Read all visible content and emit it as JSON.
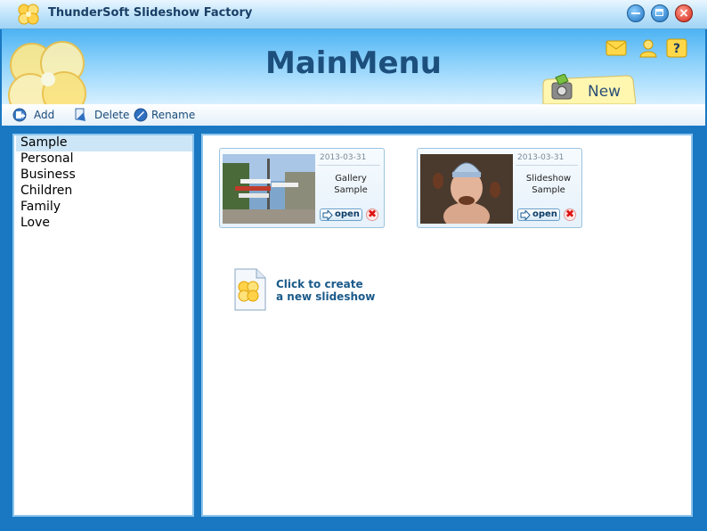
{
  "window": {
    "title": "ThunderSoft Slideshow Factory"
  },
  "header": {
    "title": "MainMenu",
    "new_label": "New"
  },
  "toolbar": {
    "add_label": "Add",
    "delete_label": "Delete",
    "rename_label": "Rename"
  },
  "categories": [
    {
      "label": "Sample",
      "selected": true
    },
    {
      "label": "Personal"
    },
    {
      "label": "Business"
    },
    {
      "label": "Children"
    },
    {
      "label": "Family"
    },
    {
      "label": "Love"
    }
  ],
  "slideshows": [
    {
      "date": "2013-03-31",
      "name_line1": "Gallery",
      "name_line2": "Sample",
      "open_label": "open",
      "delete_glyph": "✖"
    },
    {
      "date": "2013-03-31",
      "name_line1": "Slideshow",
      "name_line2": "Sample",
      "open_label": "open",
      "delete_glyph": "✖"
    }
  ],
  "create": {
    "line1": "Click to create",
    "line2": "a new slideshow"
  },
  "colors": {
    "accent": "#1a78c2",
    "title_text": "#1d4f7d",
    "selection": "#cde6f7"
  }
}
